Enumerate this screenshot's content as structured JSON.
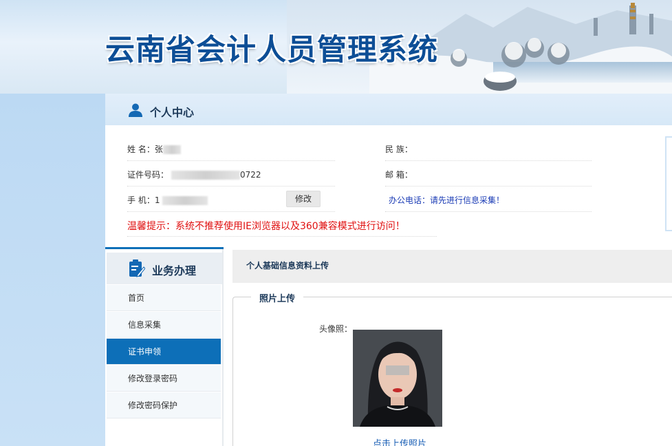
{
  "app": {
    "title": "云南省会计人员管理系统"
  },
  "personal_center": {
    "title": "个人中心",
    "fields": {
      "name_label": "姓 名：",
      "name_value": "张",
      "id_label": "证件号码：",
      "id_value": "0722",
      "phone_label": "手 机：",
      "phone_value": "1",
      "ethnicity_label": "民 族：",
      "mail_label": "邮 箱：",
      "modify_button": "修改",
      "office_phone": "办公电话：请先进行信息采集！"
    },
    "warning": "温馨提示：系统不推荐使用IE浏览器以及360兼容模式进行访问！"
  },
  "sidebar": {
    "title": "业务办理",
    "items": [
      {
        "label": "首页",
        "active": false
      },
      {
        "label": "信息采集",
        "active": false
      },
      {
        "label": "证书申领",
        "active": true
      },
      {
        "label": "修改登录密码",
        "active": false
      },
      {
        "label": "修改密码保护",
        "active": false
      }
    ]
  },
  "content": {
    "title": "个人基础信息资料上传",
    "section_legend": "照片上传",
    "photo_label": "头像照：",
    "upload_link": "点击上传照片"
  },
  "colors": {
    "accent": "#0d6fb8",
    "warning": "#e01010",
    "title": "#0d4e96"
  }
}
